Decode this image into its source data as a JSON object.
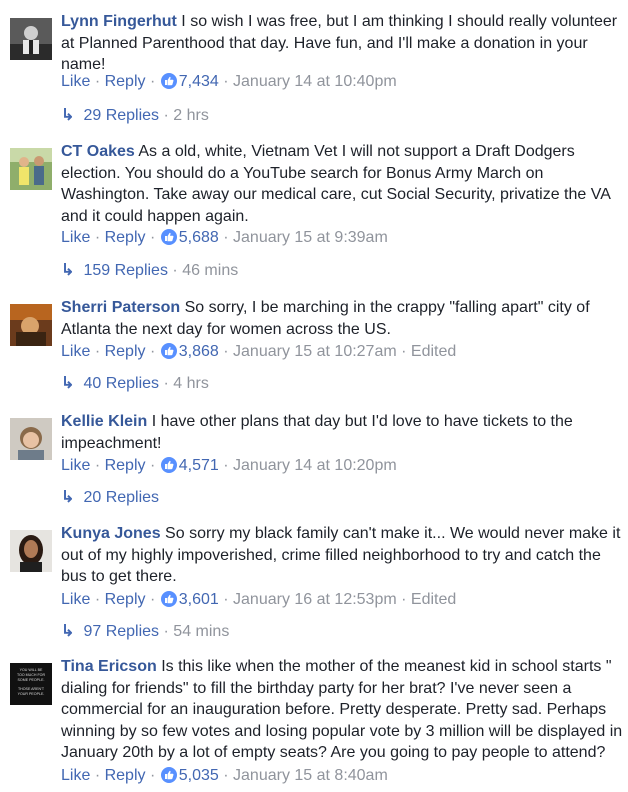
{
  "comments": [
    {
      "author": "Lynn Fingerhut",
      "text": "I so wish I was free, but I am thinking I should really volunteer at Planned Parenthood that day. Have fun, and I'll make a donation in your name!",
      "like_label": "Like",
      "reply_label": "Reply",
      "reactions": "7,434",
      "timestamp": "January 14 at 10:40pm",
      "edited": "",
      "replies_label": "29 Replies",
      "replies_age": "2 hrs"
    },
    {
      "author": "CT Oakes",
      "text": "As a old, white, Vietnam Vet I will not support a Draft Dodgers election. You should do a YouTube search for Bonus Army March on Washington. Take away our medical care, cut Social Security, privatize the VA and it could happen again.",
      "like_label": "Like",
      "reply_label": "Reply",
      "reactions": "5,688",
      "timestamp": "January 15 at 9:39am",
      "edited": "",
      "replies_label": "159 Replies",
      "replies_age": "46 mins"
    },
    {
      "author": "Sherri Paterson",
      "text": "So sorry, I be marching in the crappy \"falling apart\" city of Atlanta the next day for women across the US.",
      "like_label": "Like",
      "reply_label": "Reply",
      "reactions": "3,868",
      "timestamp": "January 15 at 10:27am",
      "edited": "Edited",
      "replies_label": "40 Replies",
      "replies_age": "4 hrs"
    },
    {
      "author": "Kellie Klein",
      "text": "I have other plans that day but I'd love to have tickets to the impeachment!",
      "like_label": "Like",
      "reply_label": "Reply",
      "reactions": "4,571",
      "timestamp": "January 14 at 10:20pm",
      "edited": "",
      "replies_label": "20 Replies",
      "replies_age": ""
    },
    {
      "author": "Kunya Jones",
      "text": "So sorry my black family can't make it... We would never make it out of my highly impoverished, crime filled neighborhood to try and catch the bus to get there.",
      "like_label": "Like",
      "reply_label": "Reply",
      "reactions": "3,601",
      "timestamp": "January 16 at 12:53pm",
      "edited": "Edited",
      "replies_label": "97 Replies",
      "replies_age": "54 mins"
    },
    {
      "author": "Tina Ericson",
      "text": "Is this like when the mother of the meanest kid in school starts \" dialing for friends\" to fill the birthday party for her brat? I've never seen a commercial for an inauguration before. Pretty desperate. Pretty sad. Perhaps winning by so few votes and losing popular vote by 3 million will be displayed in January 20th by a lot of empty seats? Are you going to pay people to attend?",
      "like_label": "Like",
      "reply_label": "Reply",
      "reactions": "5,035",
      "timestamp": "January 15 at 8:40am",
      "edited": "",
      "replies_label": "",
      "replies_age": "",
      "avatar_text": [
        "YOU WILL BE",
        "TOO MUCH FOR",
        "SOME PEOPLE.",
        "THOSE AREN'T",
        "YOUR PEOPLE."
      ]
    }
  ],
  "separator": "·",
  "reply_arrow_icon": "reply-arrow-icon",
  "like_icon": "thumbs-up-icon",
  "colors": {
    "author": "#365899",
    "link": "#4267b2",
    "meta": "#90949c",
    "text": "#1d2129",
    "like_badge": "#5890ff"
  }
}
